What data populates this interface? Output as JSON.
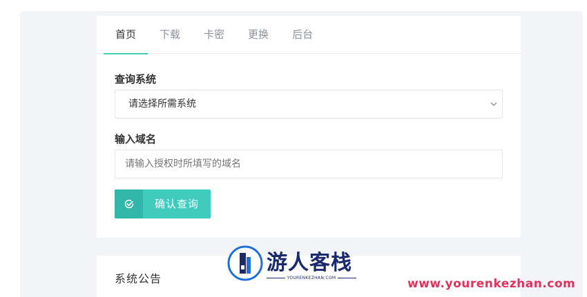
{
  "tabs": [
    {
      "label": "首页",
      "active": true
    },
    {
      "label": "下载",
      "active": false
    },
    {
      "label": "卡密",
      "active": false
    },
    {
      "label": "更换",
      "active": false
    },
    {
      "label": "后台",
      "active": false
    }
  ],
  "form": {
    "system_label": "查询系统",
    "system_select_value": "请选择所需系统",
    "domain_label": "输入域名",
    "domain_placeholder": "请输入授权时所填写的域名",
    "confirm_button": "确认查询"
  },
  "notice": {
    "title": "系统公告"
  },
  "watermark": {
    "brand_cn": "游人客栈",
    "brand_en": "YOURENKEZHAN.COM",
    "url": "www.yourenkezhan.com"
  },
  "colors": {
    "accent": "#3fcbbd",
    "accent_dark": "#31b6a9",
    "background": "#f2f4f7",
    "watermark_navy": "#1a2a6c",
    "watermark_red": "#e0325a"
  },
  "icons": {
    "select_chevron": "chevron-down-icon",
    "confirm_button_icon": "check-circle-icon"
  }
}
